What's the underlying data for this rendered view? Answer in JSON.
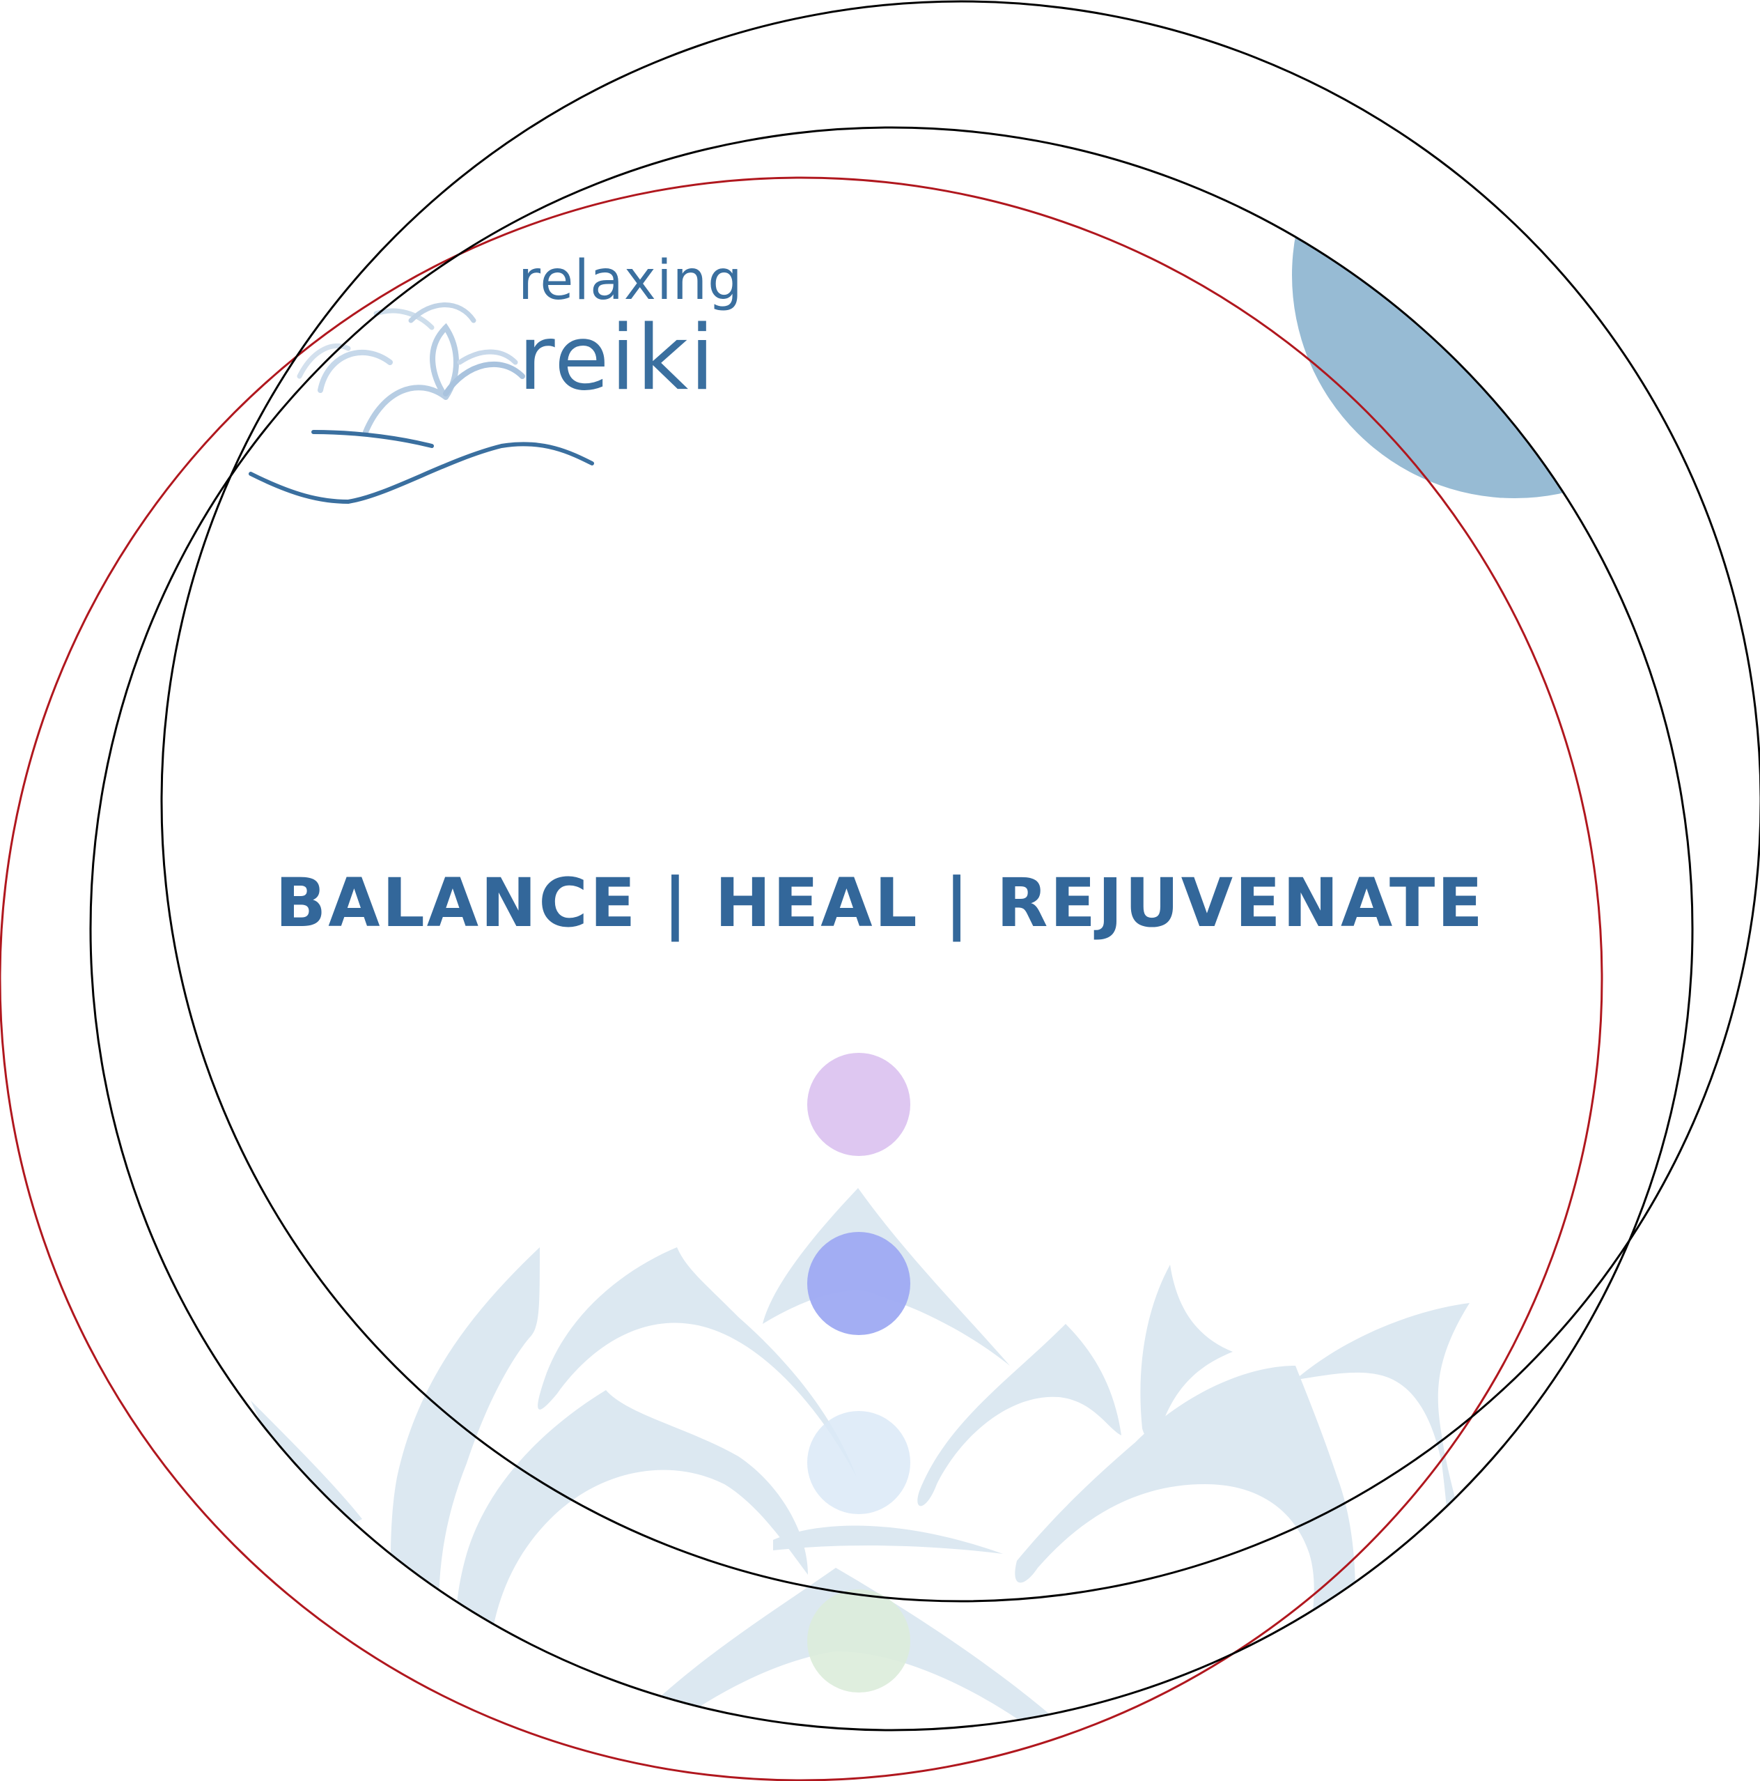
{
  "brand": {
    "line1": "relaxing",
    "line2": "reiki",
    "color": "#3a6f9f"
  },
  "tagline": "BALANCE | HEAL | REJUVENATE",
  "colors": {
    "accent_circle": "#97bbd4",
    "lotus": "#dce8f1",
    "dot_violet": "#dec7f1",
    "dot_indigo": "#9eaaf2",
    "dot_sky": "#dbe9f7",
    "dot_green": "#dcecda",
    "outline_black": "#000000",
    "outline_red": "#b0171e"
  }
}
